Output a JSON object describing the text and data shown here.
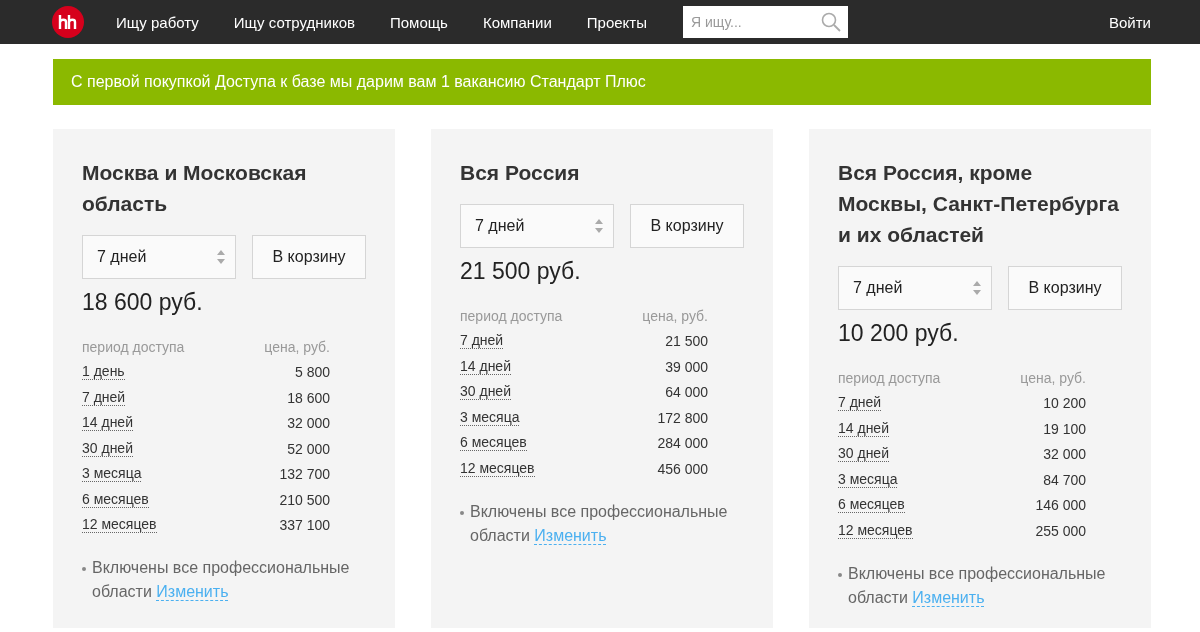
{
  "header": {
    "nav": [
      "Ищу работу",
      "Ищу сотрудников",
      "Помощь",
      "Компании",
      "Проекты"
    ],
    "search": {
      "placeholder": "Я ищу..."
    },
    "login": "Войти"
  },
  "banner": "С первой покупкой Доступа к базе мы дарим вам 1 вакансию Стандарт Плюс",
  "cards": [
    {
      "title": "Москва и Московская область",
      "period": "7 дней",
      "cart": "В корзину",
      "price": "18 600 руб.",
      "col_period": "период доступа",
      "col_price": "цена, руб.",
      "rows": [
        [
          "1 день",
          "5 800"
        ],
        [
          "7 дней",
          "18 600"
        ],
        [
          "14 дней",
          "32 000"
        ],
        [
          "30 дней",
          "52 000"
        ],
        [
          "3 месяца",
          "132 700"
        ],
        [
          "6 месяцев",
          "210 500"
        ],
        [
          "12 месяцев",
          "337 100"
        ]
      ],
      "note": "Включены все профессиональные области",
      "link": "Изменить"
    },
    {
      "title": "Вся Россия",
      "period": "7 дней",
      "cart": "В корзину",
      "price": "21 500 руб.",
      "col_period": "период доступа",
      "col_price": "цена, руб.",
      "rows": [
        [
          "7 дней",
          "21 500"
        ],
        [
          "14 дней",
          "39 000"
        ],
        [
          "30 дней",
          "64 000"
        ],
        [
          "3 месяца",
          "172 800"
        ],
        [
          "6 месяцев",
          "284 000"
        ],
        [
          "12 месяцев",
          "456 000"
        ]
      ],
      "note": "Включены все профессиональные области",
      "link": "Изменить"
    },
    {
      "title": "Вся Россия, кроме Москвы, Санкт-Петербурга и их областей",
      "period": "7 дней",
      "cart": "В корзину",
      "price": "10 200 руб.",
      "col_period": "период доступа",
      "col_price": "цена, руб.",
      "rows": [
        [
          "7 дней",
          "10 200"
        ],
        [
          "14 дней",
          "19 100"
        ],
        [
          "30 дней",
          "32 000"
        ],
        [
          "3 месяца",
          "84 700"
        ],
        [
          "6 месяцев",
          "146 000"
        ],
        [
          "12 месяцев",
          "255 000"
        ]
      ],
      "note": "Включены все профессиональные области",
      "link": "Изменить"
    }
  ]
}
